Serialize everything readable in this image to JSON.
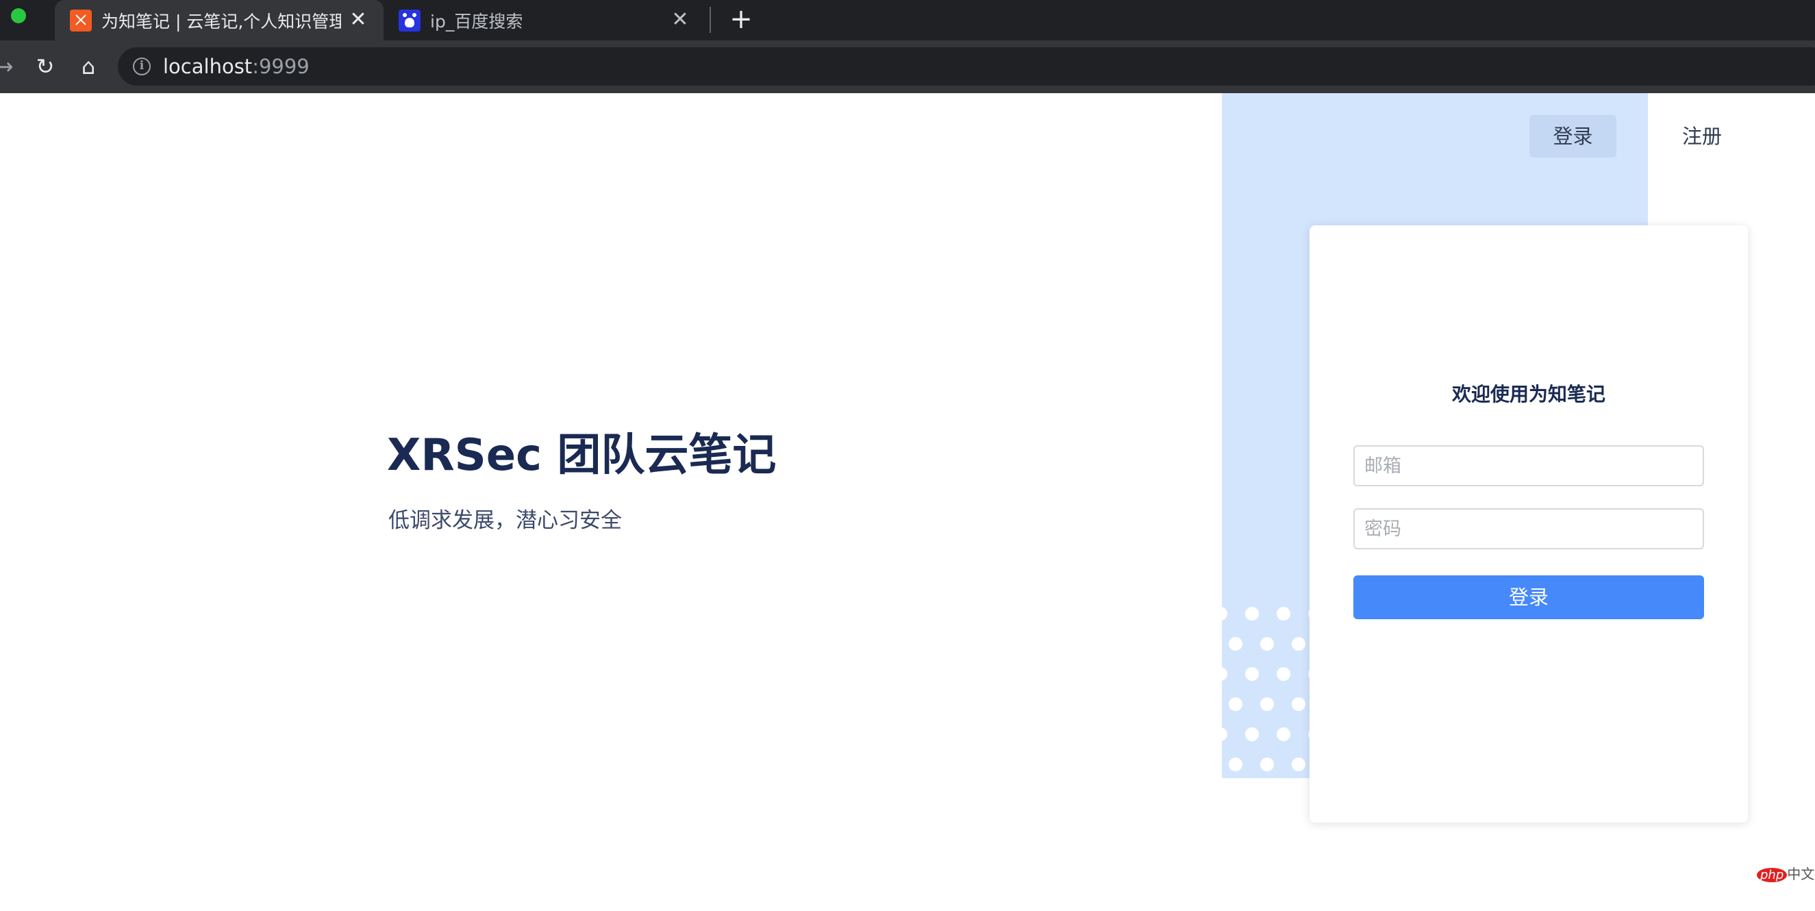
{
  "browser": {
    "tabs": [
      {
        "title": "为知笔记 | 云笔记,个人知识管理,团队协作",
        "favicon": "wiz-x-icon",
        "active": true
      },
      {
        "title": "ip_百度搜索",
        "favicon": "baidu-paw-icon",
        "active": false
      }
    ],
    "new_tab_symbol": "+",
    "close_symbol": "✕",
    "address": {
      "host": "localhost",
      "port": ":9999"
    },
    "icons": {
      "reload": "↻",
      "home": "⌂",
      "forward": "→",
      "info": "i"
    }
  },
  "nav": {
    "login_label": "登录",
    "register_label": "注册"
  },
  "hero": {
    "title": "XRSec 团队云笔记",
    "subtitle": "低调求发展，潜心习安全"
  },
  "login_form": {
    "title": "欢迎使用为知笔记",
    "email_placeholder": "邮箱",
    "password_placeholder": "密码",
    "submit_label": "登录"
  },
  "watermark": {
    "logo": "php",
    "text": "中文网"
  },
  "colors": {
    "accent_blue": "#4589fa",
    "panel_blue": "#d3e5fd",
    "heading_navy": "#1a2a52",
    "browser_dark": "#202124",
    "traffic_green": "#28c840"
  }
}
